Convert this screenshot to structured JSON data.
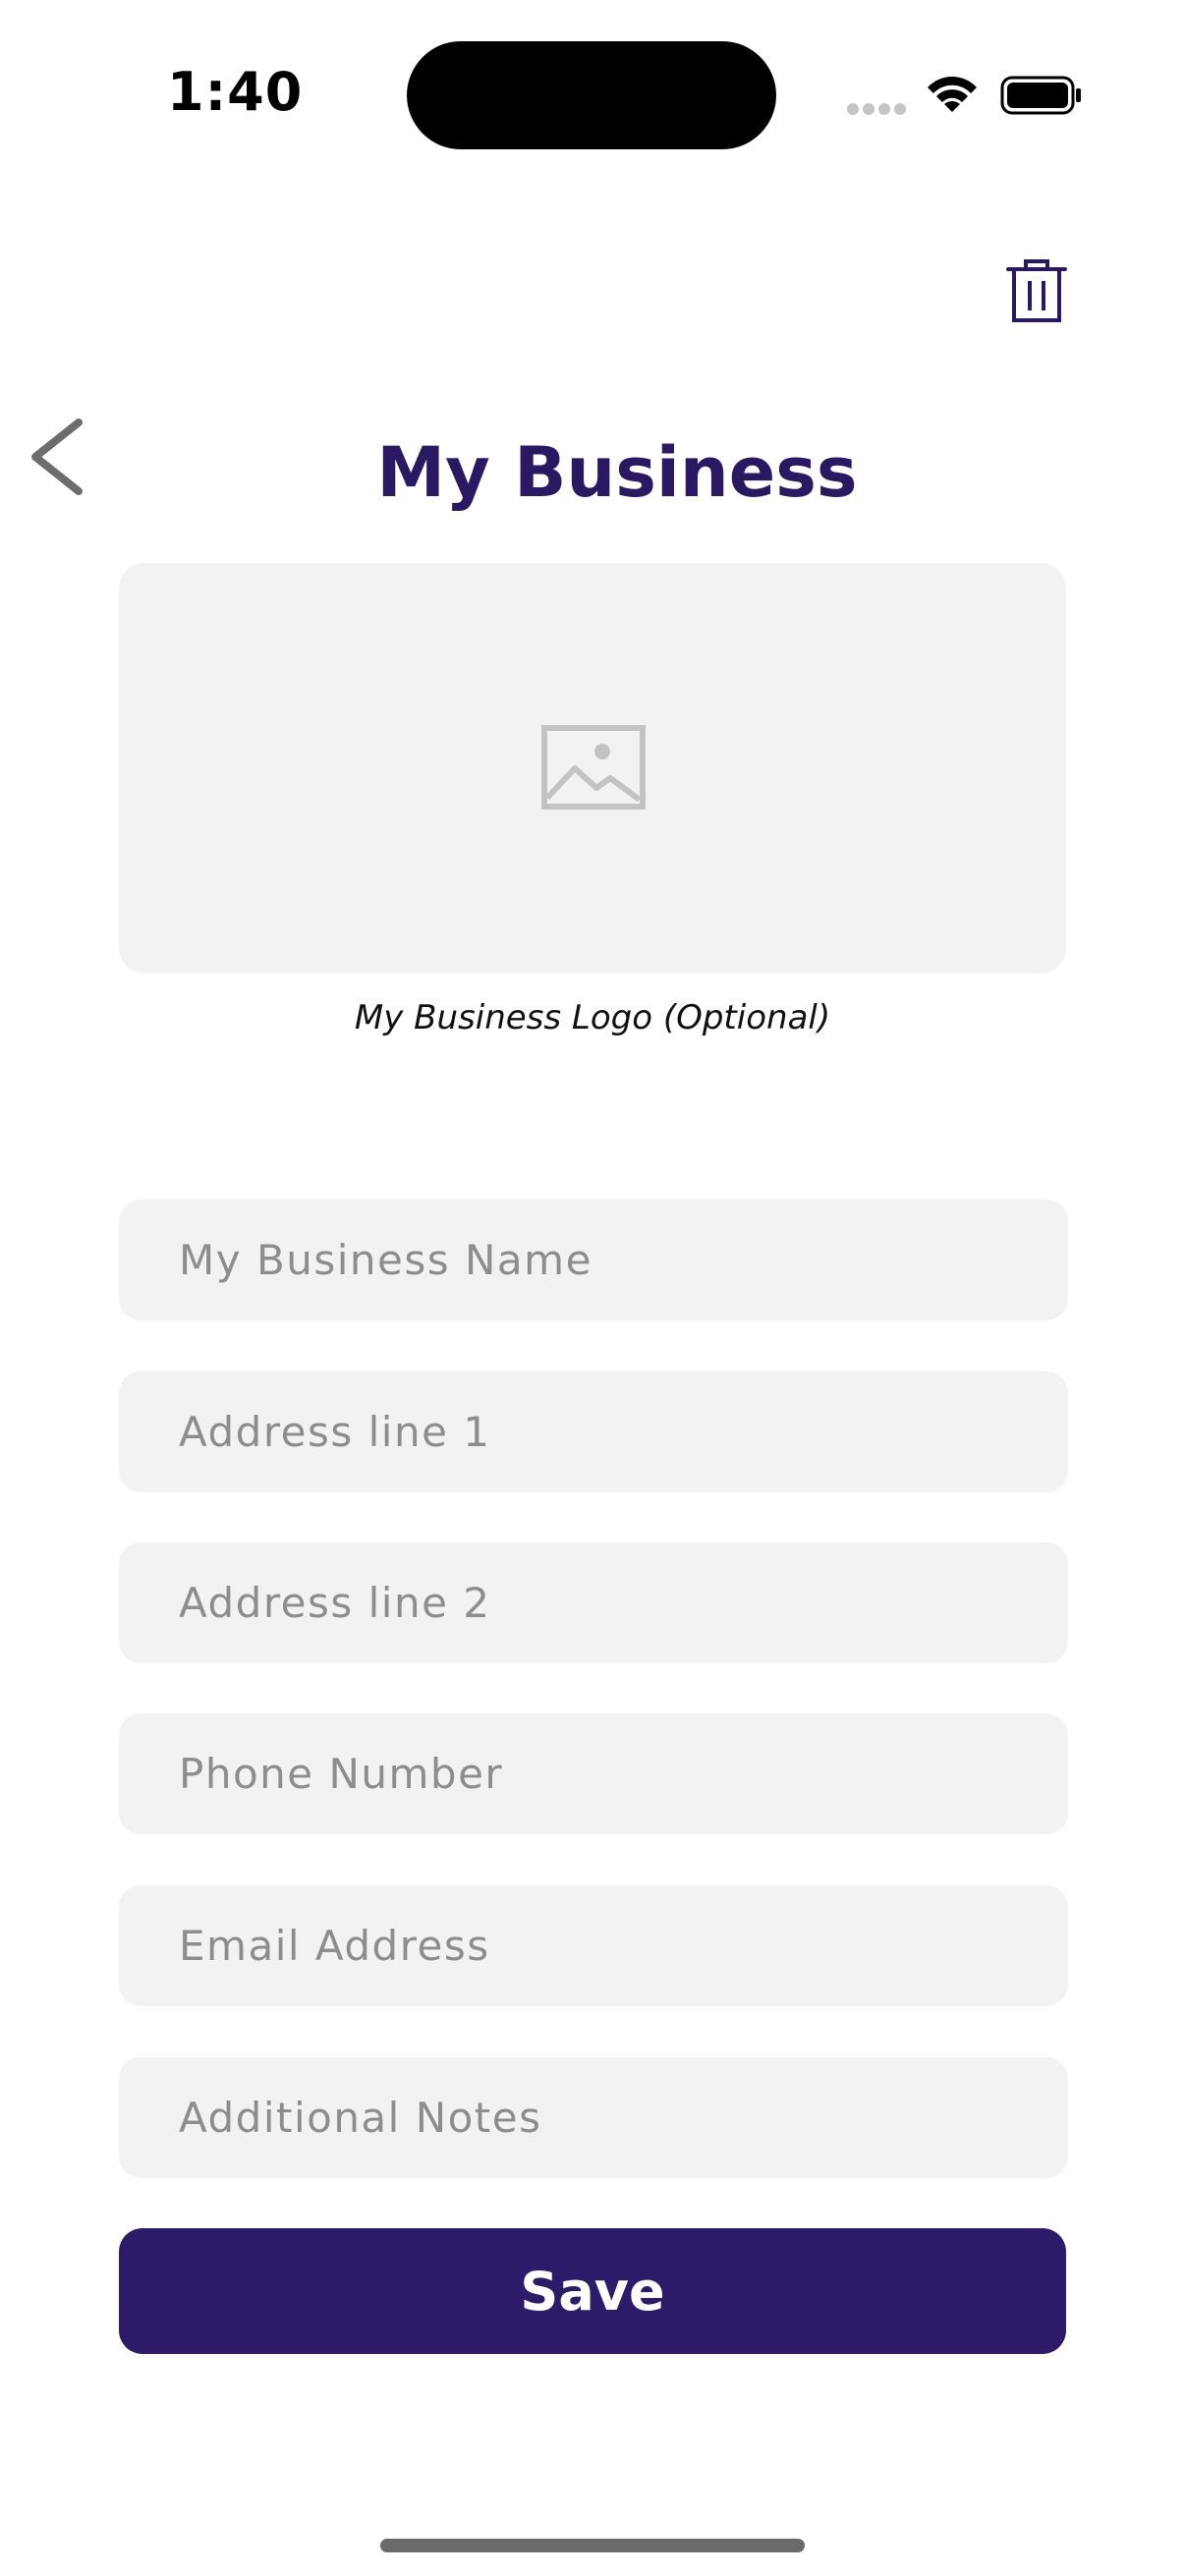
{
  "status_bar": {
    "time": "1:40"
  },
  "header": {
    "title": "My Business",
    "back_icon": "chevron-left-icon",
    "delete_icon": "trash-icon"
  },
  "logo": {
    "icon": "image-placeholder-icon",
    "caption": "My Business Logo (Optional)"
  },
  "form": {
    "business_name": {
      "placeholder": "My Business Name",
      "value": ""
    },
    "address_line_1": {
      "placeholder": "Address line 1",
      "value": ""
    },
    "address_line_2": {
      "placeholder": "Address line 2",
      "value": ""
    },
    "phone_number": {
      "placeholder": "Phone Number",
      "value": ""
    },
    "email_address": {
      "placeholder": "Email Address",
      "value": ""
    },
    "additional_notes": {
      "placeholder": "Additional Notes",
      "value": ""
    },
    "save_label": "Save"
  },
  "colors": {
    "brand": "#2d1a69",
    "title": "#2a1862",
    "field_background": "#f2f2f2",
    "placeholder_text": "#8d8d8d"
  }
}
